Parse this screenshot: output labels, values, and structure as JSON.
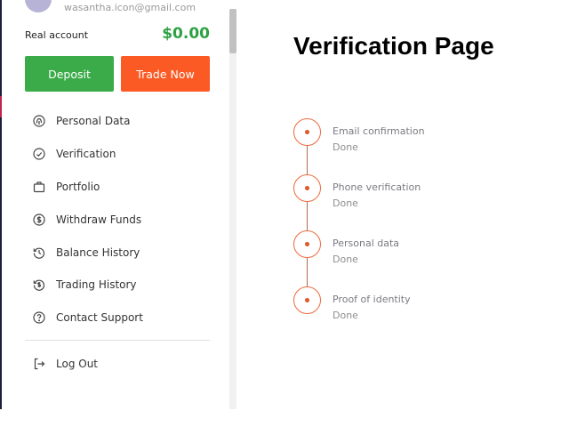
{
  "account": {
    "email": "wasantha.icon@gmail.com",
    "type_label": "Real account",
    "balance": "$0.00"
  },
  "actions": {
    "deposit_label": "Deposit",
    "trade_label": "Trade Now"
  },
  "menu": {
    "items": [
      {
        "label": "Personal Data",
        "icon": "fingerprint-icon"
      },
      {
        "label": "Verification",
        "icon": "check-circle-icon"
      },
      {
        "label": "Portfolio",
        "icon": "briefcase-icon"
      },
      {
        "label": "Withdraw Funds",
        "icon": "dollar-circle-icon"
      },
      {
        "label": "Balance History",
        "icon": "history-icon"
      },
      {
        "label": "Trading History",
        "icon": "currency-history-icon"
      },
      {
        "label": "Contact Support",
        "icon": "help-circle-icon"
      }
    ],
    "logout_label": "Log Out"
  },
  "page": {
    "title": "Verification Page"
  },
  "verification": {
    "steps": [
      {
        "title": "Email confirmation",
        "status": "Done"
      },
      {
        "title": "Phone verification",
        "status": "Done"
      },
      {
        "title": "Personal data",
        "status": "Done"
      },
      {
        "title": "Proof of identity",
        "status": "Done"
      }
    ]
  },
  "colors": {
    "deposit": "#3aab48",
    "trade": "#fb5a24",
    "balance": "#2ea143",
    "timeline_accent": "#ec6a3c"
  }
}
